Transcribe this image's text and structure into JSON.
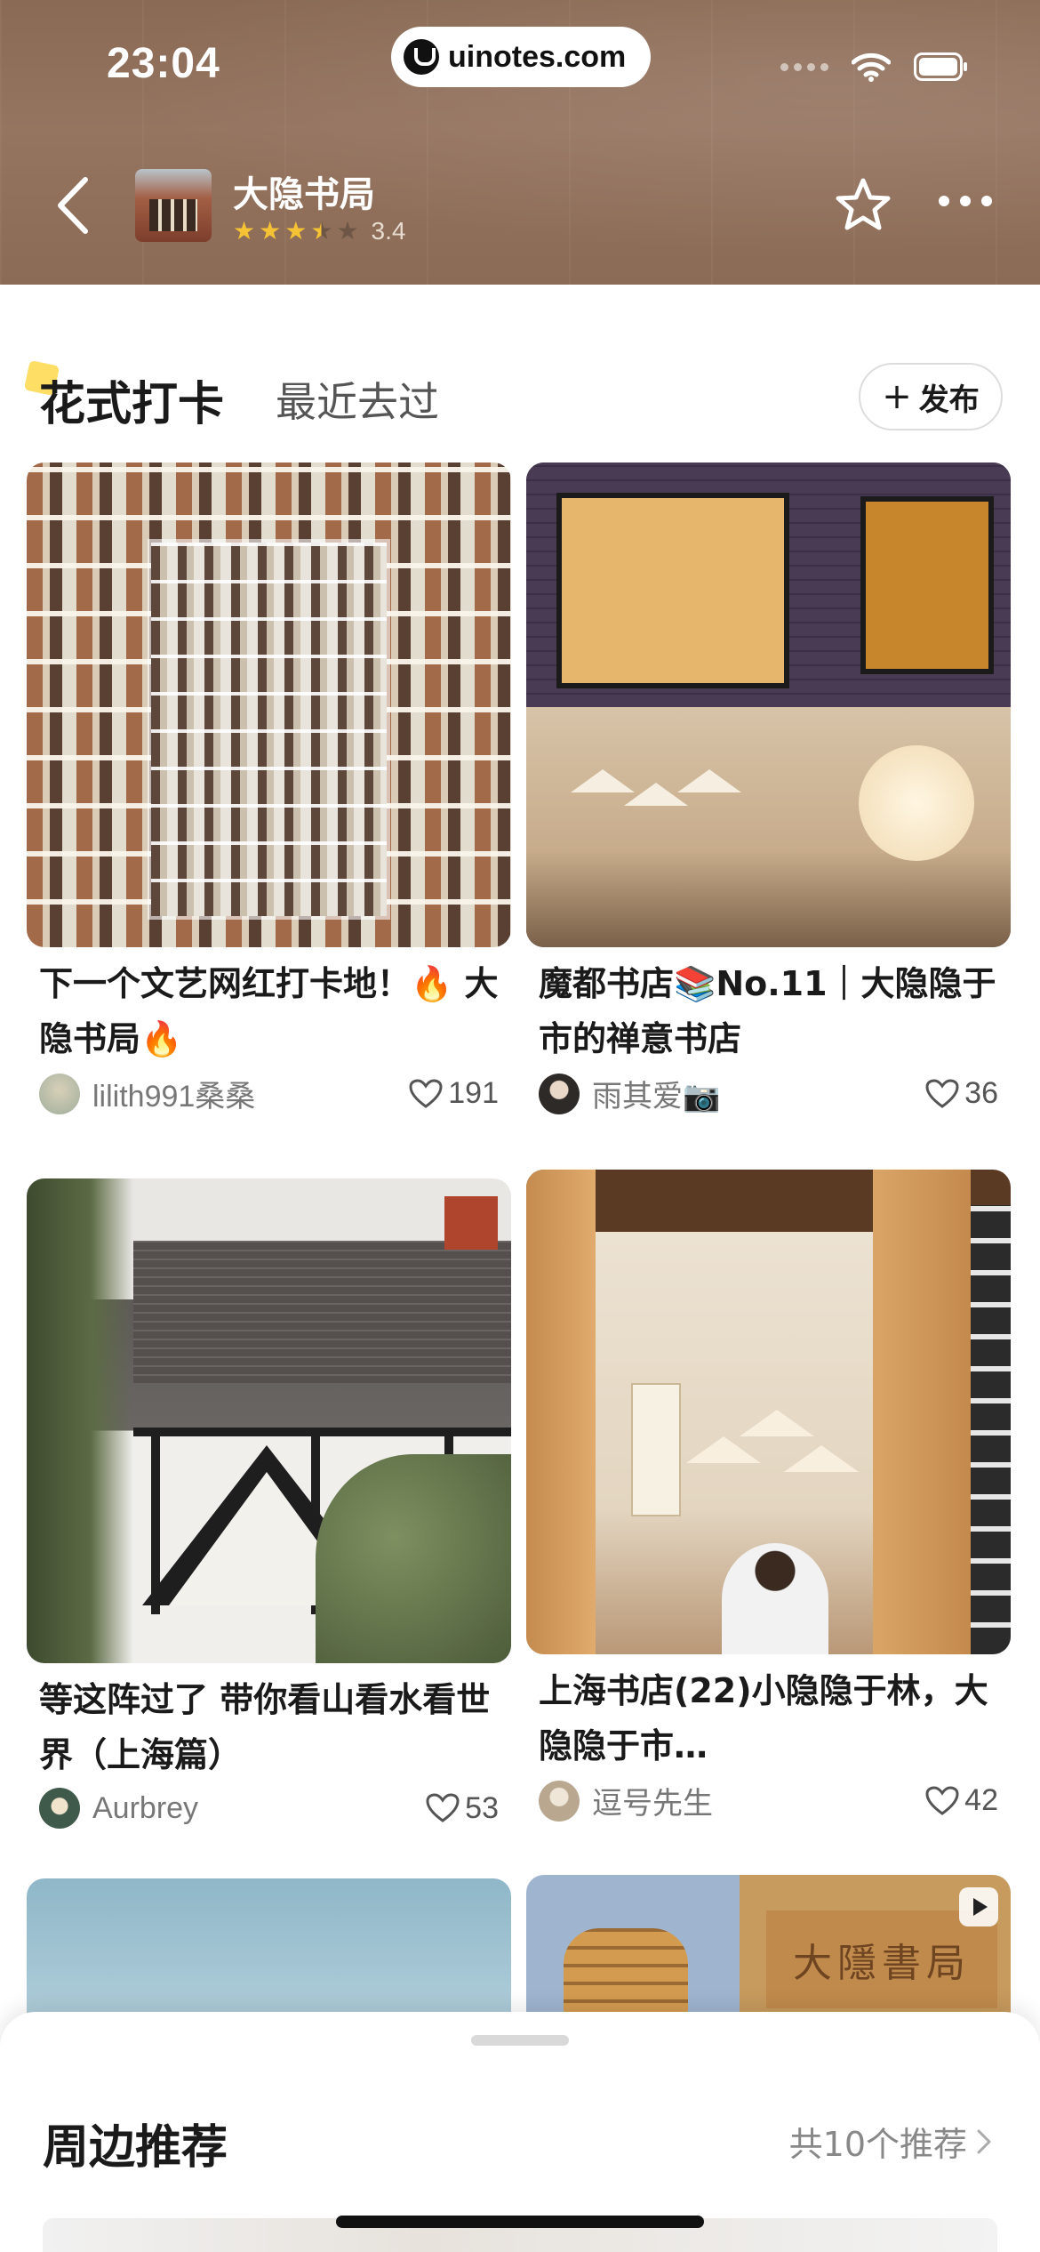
{
  "status_bar": {
    "time": "23:04",
    "url": "uinotes.com"
  },
  "header": {
    "shop_name": "大隐书局",
    "rating": 3.4,
    "rating_text": "3.4",
    "icons": [
      "back-icon",
      "star-outline-icon",
      "more-icon"
    ]
  },
  "tabs": {
    "active": "花式打卡",
    "other": "最近去过",
    "publish": "发布"
  },
  "feed": [
    {
      "title": "下一个文艺网红打卡地！🔥 大隐书局🔥",
      "author": "lilith991桑桑",
      "likes": "191",
      "image": "bookshelf-atrium"
    },
    {
      "title": "魔都书店📚No.11｜大隐隐于市的禅意书店",
      "author": "雨其爱📷",
      "likes": "36",
      "image": "storefront-and-zen-room"
    },
    {
      "title": "等这阵过了 带你看山看水看世界（上海篇）",
      "author": "Aurbrey",
      "likes": "53",
      "image": "tudor-house"
    },
    {
      "title": "上海书店(22)小隐隐于林，大隐隐于市…",
      "author": "逗号先生",
      "likes": "42",
      "image": "bookstore-interior"
    },
    {
      "title": "",
      "author": "",
      "likes": "",
      "image": "sky"
    },
    {
      "title": "",
      "author": "",
      "likes": "",
      "image": "building-and-sign",
      "sign_text": "大隱書局"
    }
  ],
  "sheet": {
    "title": "周边推荐",
    "count": "共10个推荐"
  },
  "colors": {
    "header_bg": "#8f6f5a",
    "star": "#f6c235",
    "tab_highlight": "#ffd84a"
  }
}
